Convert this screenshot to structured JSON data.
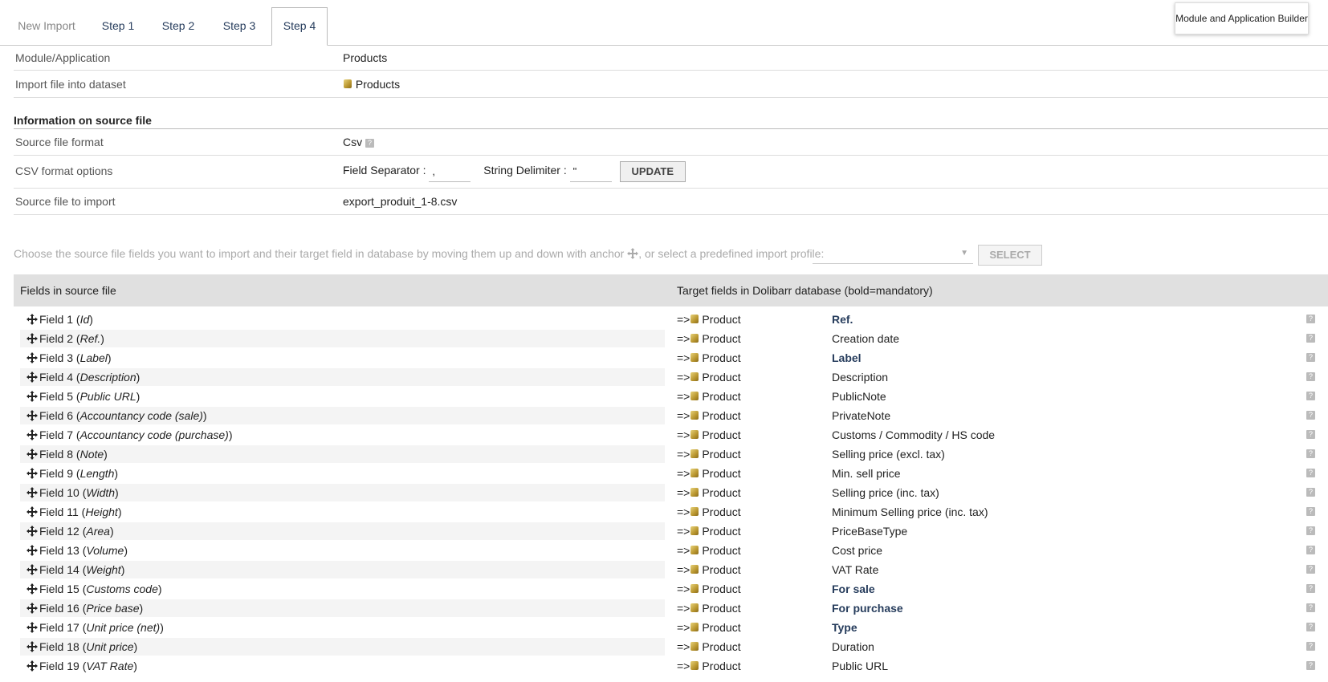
{
  "tabs": [
    {
      "label": "New Import",
      "state": "disabled"
    },
    {
      "label": "Step 1",
      "state": "normal"
    },
    {
      "label": "Step 2",
      "state": "normal"
    },
    {
      "label": "Step 3",
      "state": "normal"
    },
    {
      "label": "Step 4",
      "state": "active"
    }
  ],
  "builder_button": "Module and Application Builder",
  "info": {
    "module_label": "Module/Application",
    "module_value": "Products",
    "dataset_label": "Import file into dataset",
    "dataset_value": "Products"
  },
  "source": {
    "section_title": "Information on source file",
    "format_label": "Source file format",
    "format_value": "Csv",
    "csv_label": "CSV format options",
    "field_sep_label": "Field Separator :",
    "field_sep_value": ",",
    "string_delim_label": "String Delimiter :",
    "string_delim_value": "\"",
    "update_button": "UPDATE",
    "file_label": "Source file to import",
    "file_value": "export_produit_1-8.csv"
  },
  "instruction": {
    "text_before": "Choose the source file fields you want to import and their target field in database by moving them up and down with anchor",
    "text_after": ", or select a predefined import profile:",
    "select_button": "SELECT"
  },
  "mapping": {
    "header_source": "Fields in source file",
    "header_target": "Target fields in Dolibarr database (bold=mandatory)",
    "arrow": "=>",
    "rows": [
      {
        "field": "Field 1",
        "name": "Id",
        "entity": "Product",
        "target": "Ref.",
        "mandatory": true
      },
      {
        "field": "Field 2",
        "name": "Ref.",
        "entity": "Product",
        "target": "Creation date",
        "mandatory": false
      },
      {
        "field": "Field 3",
        "name": "Label",
        "entity": "Product",
        "target": "Label",
        "mandatory": true
      },
      {
        "field": "Field 4",
        "name": "Description",
        "entity": "Product",
        "target": "Description",
        "mandatory": false
      },
      {
        "field": "Field 5",
        "name": "Public URL",
        "entity": "Product",
        "target": "PublicNote",
        "mandatory": false
      },
      {
        "field": "Field 6",
        "name": "Accountancy code (sale)",
        "entity": "Product",
        "target": "PrivateNote",
        "mandatory": false
      },
      {
        "field": "Field 7",
        "name": "Accountancy code (purchase)",
        "entity": "Product",
        "target": "Customs / Commodity / HS code",
        "mandatory": false
      },
      {
        "field": "Field 8",
        "name": "Note",
        "entity": "Product",
        "target": "Selling price (excl. tax)",
        "mandatory": false
      },
      {
        "field": "Field 9",
        "name": "Length",
        "entity": "Product",
        "target": "Min. sell price",
        "mandatory": false
      },
      {
        "field": "Field 10",
        "name": "Width",
        "entity": "Product",
        "target": "Selling price (inc. tax)",
        "mandatory": false
      },
      {
        "field": "Field 11",
        "name": "Height",
        "entity": "Product",
        "target": "Minimum Selling price (inc. tax)",
        "mandatory": false
      },
      {
        "field": "Field 12",
        "name": "Area",
        "entity": "Product",
        "target": "PriceBaseType",
        "mandatory": false
      },
      {
        "field": "Field 13",
        "name": "Volume",
        "entity": "Product",
        "target": "Cost price",
        "mandatory": false
      },
      {
        "field": "Field 14",
        "name": "Weight",
        "entity": "Product",
        "target": "VAT Rate",
        "mandatory": false
      },
      {
        "field": "Field 15",
        "name": "Customs code",
        "entity": "Product",
        "target": "For sale",
        "mandatory": true
      },
      {
        "field": "Field 16",
        "name": "Price base",
        "entity": "Product",
        "target": "For purchase",
        "mandatory": true
      },
      {
        "field": "Field 17",
        "name": "Unit price (net)",
        "entity": "Product",
        "target": "Type",
        "mandatory": true
      },
      {
        "field": "Field 18",
        "name": "Unit price",
        "entity": "Product",
        "target": "Duration",
        "mandatory": false
      },
      {
        "field": "Field 19",
        "name": "VAT Rate",
        "entity": "Product",
        "target": "Public URL",
        "mandatory": false
      }
    ]
  },
  "colors": {
    "link": "#263c5c",
    "header_bg": "#e0e0e0",
    "alt_row": "#f4f4f4"
  }
}
